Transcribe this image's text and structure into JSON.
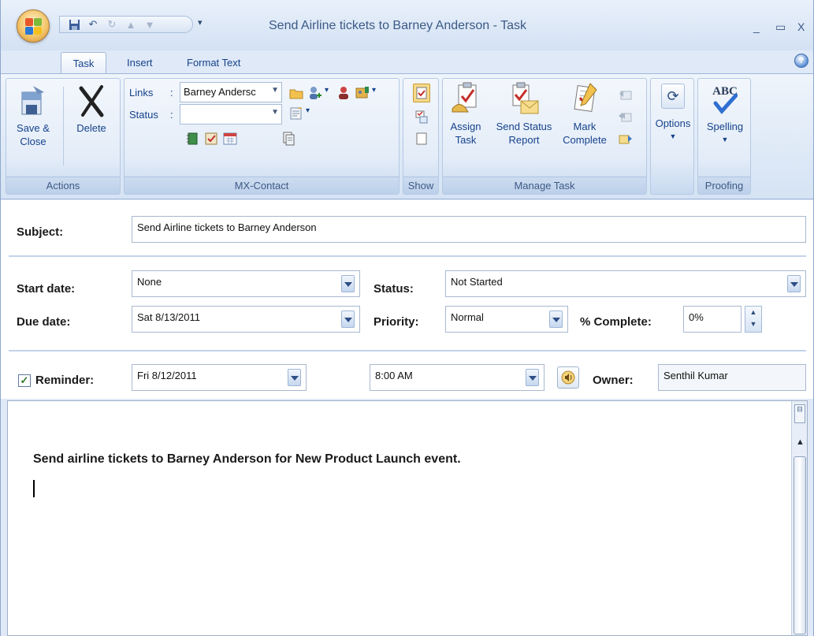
{
  "window": {
    "title": "Send Airline tickets to Barney Anderson - Task",
    "minimize": "_",
    "restore": "▭",
    "close": "X"
  },
  "qat": {
    "more": "▾"
  },
  "tabs": [
    {
      "label": "Task",
      "active": true
    },
    {
      "label": "Insert",
      "active": false
    },
    {
      "label": "Format Text",
      "active": false
    }
  ],
  "help": "?",
  "ribbon": {
    "actions": {
      "group_label": "Actions",
      "save_close_line1": "Save &",
      "save_close_line2": "Close",
      "delete": "Delete"
    },
    "mx_contact": {
      "group_label": "MX-Contact",
      "links_label": "Links",
      "links_value": "Barney Andersc",
      "status_label": "Status",
      "status_value": ""
    },
    "show": {
      "group_label": "Show"
    },
    "manage_task": {
      "group_label": "Manage Task",
      "assign_line1": "Assign",
      "assign_line2": "Task",
      "send_status_line1": "Send Status",
      "send_status_line2": "Report",
      "mark_complete_line1": "Mark",
      "mark_complete_line2": "Complete"
    },
    "options": {
      "label": "Options"
    },
    "proofing": {
      "group_label": "Proofing",
      "spelling": "Spelling",
      "abc": "ABC"
    }
  },
  "form": {
    "subject_label": "Subject:",
    "subject_value": "Send Airline tickets to Barney Anderson",
    "start_date_label": "Start date:",
    "start_date_value": "None",
    "due_date_label": "Due date:",
    "due_date_value": "Sat 8/13/2011",
    "status_label": "Status:",
    "status_value": "Not Started",
    "priority_label": "Priority:",
    "priority_value": "Normal",
    "percent_label": "% Complete:",
    "percent_value": "0%",
    "reminder_label": "Reminder:",
    "reminder_checked": true,
    "reminder_date": "Fri 8/12/2011",
    "reminder_time": "8:00 AM",
    "owner_label": "Owner:",
    "owner_value": "Senthil Kumar"
  },
  "body": {
    "text": "Send airline tickets to Barney Anderson for New Product Launch event."
  },
  "colors": {
    "ribbon_text": "#15428b",
    "frame": "#dfe9f7",
    "check_green": "#2a7a2a"
  }
}
